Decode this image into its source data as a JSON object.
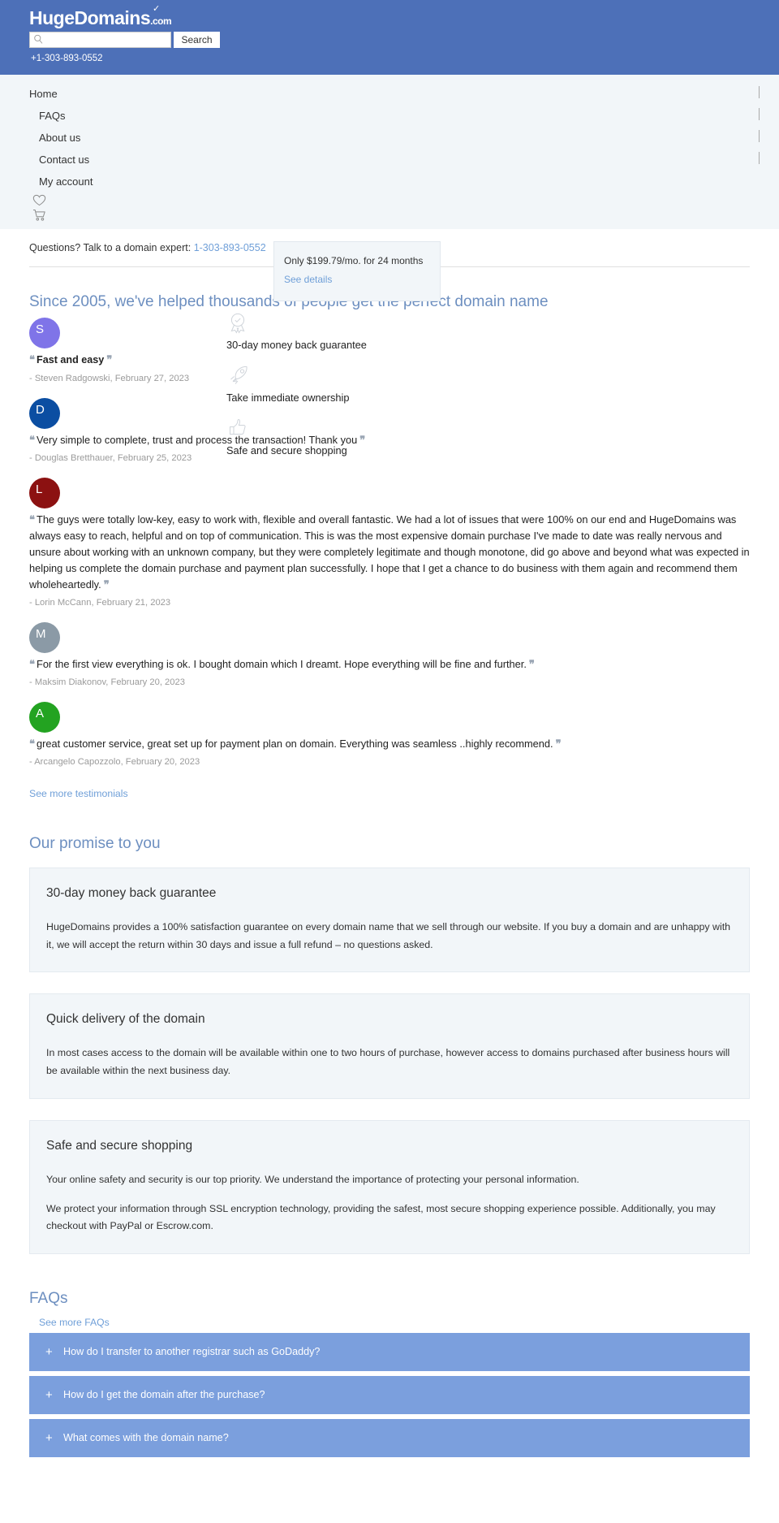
{
  "header": {
    "logo_main": "HugeDomains",
    "logo_suffix": ".com",
    "search_value": "",
    "search_placeholder": "",
    "search_button": "Search",
    "phone": "+1-303-893-0552"
  },
  "nav": {
    "items": [
      {
        "label": "Home",
        "indented": false
      },
      {
        "label": "FAQs",
        "indented": true
      },
      {
        "label": "About us",
        "indented": true
      },
      {
        "label": "Contact us",
        "indented": true
      },
      {
        "label": "My account",
        "indented": true
      }
    ],
    "icons": [
      "heart-icon",
      "cart-icon"
    ]
  },
  "expert": {
    "text": "Questions? Talk to a domain expert:",
    "phone": "1-303-893-0552"
  },
  "price_popup": {
    "text": "Only $199.79/mo. for 24 months",
    "link": "See details"
  },
  "testimonials_section": {
    "title": "Since 2005, we've helped thousands of people get the perfect domain name",
    "see_more": "See more testimonials",
    "items": [
      {
        "initial": "S",
        "color": "#7f74e8",
        "quote": "Fast and easy",
        "bold": true,
        "author": "- Steven Radgowski, February 27, 2023"
      },
      {
        "initial": "D",
        "color": "#0b4ea2",
        "quote": "Very simple to complete, trust and process the transaction! Thank you",
        "bold": false,
        "author": "- Douglas Bretthauer, February 25, 2023"
      },
      {
        "initial": "L",
        "color": "#8c1111",
        "quote": "The guys were totally low-key, easy to work with, flexible and overall fantastic. We had a lot of issues that were 100% on our end and HugeDomains was always easy to reach, helpful and on top of communication. This is was the most expensive domain purchase I've made to date was really nervous and unsure about working with an unknown company, but they were completely legitimate and though monotone, did go above and beyond what was expected in helping us complete the domain purchase and payment plan successfully. I hope that I get a chance to do business with them again and recommend them wholeheartedly.",
        "bold": false,
        "author": "- Lorin McCann, February 21, 2023"
      },
      {
        "initial": "M",
        "color": "#8b9aa6",
        "quote": "For the first view everything is ok. I bought domain which I dreamt. Hope everything will be fine and further.",
        "bold": false,
        "author": "- Maksim Diakonov, February 20, 2023"
      },
      {
        "initial": "A",
        "color": "#23a321",
        "quote": "great customer service, great set up for payment plan on domain. Everything was seamless ..highly recommend.",
        "bold": false,
        "author": "- Arcangelo Capozzolo, February 20, 2023"
      }
    ]
  },
  "features": [
    {
      "icon": "badge-icon",
      "label": "30-day money back guarantee"
    },
    {
      "icon": "rocket-icon",
      "label": "Take immediate ownership"
    },
    {
      "icon": "thumbs-up-icon",
      "label": "Safe and secure shopping"
    }
  ],
  "promise": {
    "title": "Our promise to you",
    "cards": [
      {
        "heading": "30-day money back guarantee",
        "paragraphs": [
          "HugeDomains provides a 100% satisfaction guarantee on every domain name that we sell through our website. If you buy a domain and are unhappy with it, we will accept the return within 30 days and issue a full refund – no questions asked."
        ]
      },
      {
        "heading": "Quick delivery of the domain",
        "paragraphs": [
          "In most cases access to the domain will be available within one to two hours of purchase, however access to domains purchased after business hours will be available within the next business day."
        ]
      },
      {
        "heading": "Safe and secure shopping",
        "paragraphs": [
          "Your online safety and security is our top priority. We understand the importance of protecting your personal information.",
          "We protect your information through SSL encryption technology, providing the safest, most secure shopping experience possible. Additionally, you may checkout with PayPal or Escrow.com."
        ]
      }
    ]
  },
  "faq": {
    "title": "FAQs",
    "see_more": "See more FAQs",
    "items": [
      {
        "plus": "+",
        "question": "How do I transfer to another registrar such as GoDaddy?"
      },
      {
        "plus": "+",
        "question": "How do I get the domain after the purchase?"
      },
      {
        "plus": "+",
        "question": "What comes with the domain name?"
      }
    ]
  },
  "colors": {
    "brand_blue": "#4d70b8",
    "accent_link": "#6f9fd8",
    "faq_blue": "#7b9fdd",
    "panel_bg": "#f2f6f9"
  }
}
